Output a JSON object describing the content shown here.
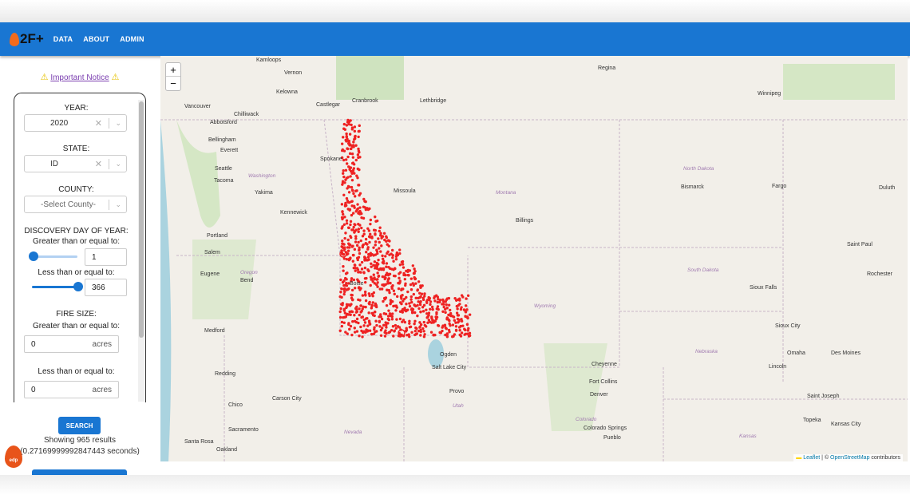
{
  "nav": {
    "logo": "2F+",
    "items": [
      "DATA",
      "ABOUT",
      "ADMIN"
    ],
    "color": "#1976d2"
  },
  "notice": {
    "label": "Important Notice",
    "icon": "warning-icon"
  },
  "filters": {
    "year": {
      "label": "YEAR:",
      "value": "2020"
    },
    "state": {
      "label": "STATE:",
      "value": "ID"
    },
    "county": {
      "label": "COUNTY:",
      "placeholder": "-Select County-"
    },
    "discovery": {
      "label": "DISCOVERY DAY OF YEAR:",
      "gte_label": "Greater than or equal to:",
      "gte_value": "1",
      "lte_label": "Less than or equal to:",
      "lte_value": "366"
    },
    "fire_size": {
      "label": "FIRE SIZE:",
      "gte_label": "Greater than or equal to:",
      "gte_value": "0",
      "lte_label": "Less than or equal to:",
      "lte_value": "0",
      "unit": "acres"
    }
  },
  "search": {
    "label": "SEARCH"
  },
  "results": {
    "count_text": "Showing 965 results",
    "time_text": "(0.27169999992847443 seconds)"
  },
  "map": {
    "zoom_in": "+",
    "zoom_out": "−",
    "attribution": {
      "leaflet": "Leaflet",
      "sep": " | © ",
      "osm": "OpenStreetMap",
      "suffix": " contributors"
    },
    "marker_color": "#ee2222",
    "cities": [
      "Kamloops",
      "Vernon",
      "Kelowna",
      "Vancouver",
      "Chilliwack",
      "Castlegar",
      "Cranbrook",
      "Lethbridge",
      "Regina",
      "Winnipeg",
      "Abbotsford",
      "Bellingham",
      "Everett",
      "Seattle",
      "Tacoma",
      "Spokane",
      "Yakima",
      "Kennewick",
      "Missoula",
      "Bismarck",
      "Fargo",
      "Duluth",
      "Billings",
      "Portland",
      "Salem",
      "Eugene",
      "Bend",
      "Saint Paul",
      "Rochester",
      "Sioux Falls",
      "Medford",
      "Sioux City",
      "Ogden",
      "Salt Lake City",
      "Cheyenne",
      "Omaha",
      "Des Moines",
      "Lincoln",
      "Fort Collins",
      "Denver",
      "Redding",
      "Provo",
      "Chico",
      "Carson City",
      "Saint Joseph",
      "Sacramento",
      "Colorado Springs",
      "Topeka",
      "Kansas City",
      "Pueblo",
      "Santa Rosa",
      "Oakland",
      "Boise"
    ],
    "states": [
      "Washington",
      "Montana",
      "North Dakota",
      "Oregon",
      "South Dakota",
      "Wyoming",
      "Nebraska",
      "Utah",
      "Colorado",
      "Nevada",
      "Kansas"
    ]
  }
}
